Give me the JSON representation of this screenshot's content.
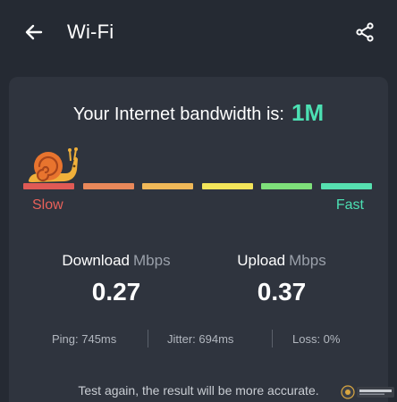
{
  "appbar": {
    "title": "Wi-Fi",
    "back_icon": "arrow-left-icon",
    "share_icon": "share-icon"
  },
  "result": {
    "headline": "Your Internet bandwidth is:",
    "bandwidth": "1M",
    "scale_slow": "Slow",
    "scale_fast": "Fast",
    "speed_level": 0.02,
    "scale_colors": [
      "#e05a55",
      "#e9885a",
      "#f0b858",
      "#f3e55a",
      "#7ee07a",
      "#56e0b0"
    ]
  },
  "download": {
    "label": "Download",
    "unit": "Mbps",
    "value": "0.27"
  },
  "upload": {
    "label": "Upload",
    "unit": "Mbps",
    "value": "0.37"
  },
  "stats": {
    "ping": "Ping: 745ms",
    "jitter": "Jitter: 694ms",
    "loss": "Loss: 0%"
  },
  "footer": {
    "retest": "Test again, the result will be more accurate."
  },
  "colors": {
    "accent": "#4ce0b3",
    "slow": "#e8615a",
    "background": "#252a33",
    "card": "#2f343e"
  }
}
